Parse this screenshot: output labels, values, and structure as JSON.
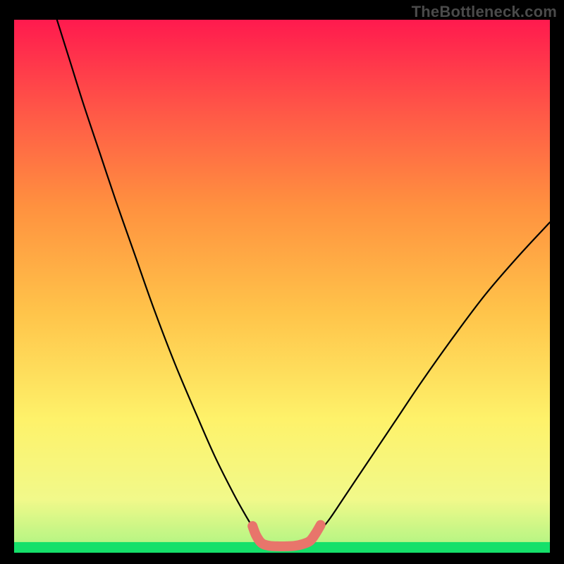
{
  "watermark": "TheBottleneck.com",
  "chart_data": {
    "type": "line",
    "title": "",
    "xlabel": "",
    "ylabel": "",
    "xlim": [
      0,
      100
    ],
    "ylim": [
      0,
      100
    ],
    "background_gradient": {
      "bottom_band_color": "#15e06a",
      "bottom_band_height_pct": 2,
      "stops": [
        {
          "pos": 0.0,
          "color": "#15e06a"
        },
        {
          "pos": 0.02,
          "color": "#b8f584"
        },
        {
          "pos": 0.1,
          "color": "#f1f98a"
        },
        {
          "pos": 0.25,
          "color": "#fef26a"
        },
        {
          "pos": 0.45,
          "color": "#ffc44a"
        },
        {
          "pos": 0.65,
          "color": "#ff913f"
        },
        {
          "pos": 0.82,
          "color": "#ff5a47"
        },
        {
          "pos": 1.0,
          "color": "#ff1a4e"
        }
      ]
    },
    "series": [
      {
        "name": "left-curve",
        "style": "thin-black",
        "points": [
          {
            "x": 8.0,
            "y": 100.0
          },
          {
            "x": 10.5,
            "y": 92.0
          },
          {
            "x": 13.0,
            "y": 84.0
          },
          {
            "x": 16.0,
            "y": 75.0
          },
          {
            "x": 19.0,
            "y": 66.0
          },
          {
            "x": 22.5,
            "y": 56.0
          },
          {
            "x": 26.0,
            "y": 46.0
          },
          {
            "x": 30.0,
            "y": 35.5
          },
          {
            "x": 34.0,
            "y": 26.0
          },
          {
            "x": 37.5,
            "y": 18.0
          },
          {
            "x": 41.0,
            "y": 11.0
          },
          {
            "x": 43.5,
            "y": 6.5
          },
          {
            "x": 45.0,
            "y": 4.0
          }
        ]
      },
      {
        "name": "right-curve",
        "style": "thin-black",
        "points": [
          {
            "x": 57.0,
            "y": 4.0
          },
          {
            "x": 59.0,
            "y": 6.5
          },
          {
            "x": 62.0,
            "y": 11.0
          },
          {
            "x": 66.0,
            "y": 17.0
          },
          {
            "x": 71.0,
            "y": 24.5
          },
          {
            "x": 76.0,
            "y": 32.0
          },
          {
            "x": 82.0,
            "y": 40.5
          },
          {
            "x": 88.0,
            "y": 48.5
          },
          {
            "x": 94.0,
            "y": 55.5
          },
          {
            "x": 100.0,
            "y": 62.0
          }
        ]
      },
      {
        "name": "bottom-marker-trail",
        "style": "thick-salmon",
        "points": [
          {
            "x": 44.5,
            "y": 5.0
          },
          {
            "x": 45.2,
            "y": 3.2
          },
          {
            "x": 46.2,
            "y": 1.8
          },
          {
            "x": 47.6,
            "y": 1.3
          },
          {
            "x": 49.2,
            "y": 1.2
          },
          {
            "x": 50.8,
            "y": 1.2
          },
          {
            "x": 52.4,
            "y": 1.3
          },
          {
            "x": 53.8,
            "y": 1.6
          },
          {
            "x": 55.2,
            "y": 2.2
          },
          {
            "x": 56.2,
            "y": 3.5
          },
          {
            "x": 57.2,
            "y": 5.2
          }
        ]
      }
    ],
    "annotations": []
  }
}
